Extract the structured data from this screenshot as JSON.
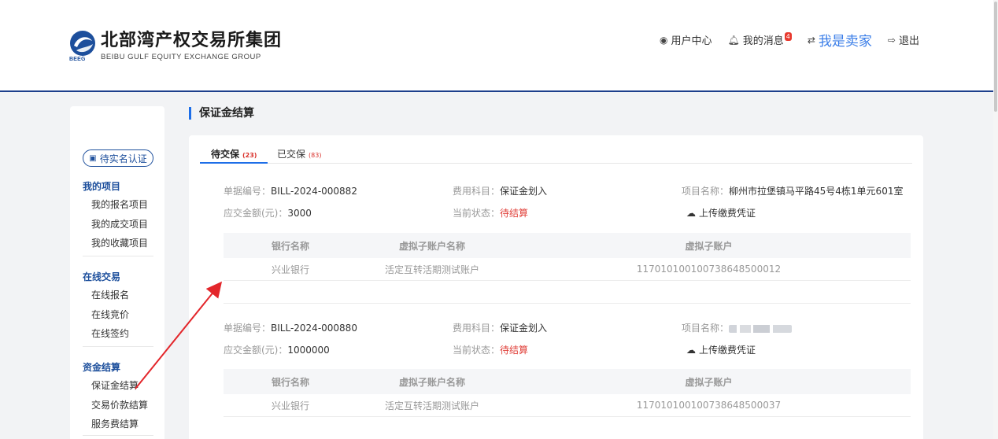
{
  "header": {
    "logo_cn": "北部湾产权交易所集团",
    "logo_en": "BEIBU GULF EQUITY EXCHANGE GROUP",
    "logo_abbr": "BEEG",
    "nav": {
      "user_center": "用户中心",
      "messages": "我的消息",
      "messages_badge": "4",
      "seller": "我是卖家",
      "logout": "退出"
    }
  },
  "sidebar": {
    "verify_button": "待实名认证",
    "groups": [
      {
        "title": "我的项目",
        "items": [
          "我的报名项目",
          "我的成交项目",
          "我的收藏项目"
        ]
      },
      {
        "title": "在线交易",
        "items": [
          "在线报名",
          "在线竞价",
          "在线签约"
        ]
      },
      {
        "title": "资金结算",
        "items": [
          "保证金结算",
          "交易价款结算",
          "服务费结算"
        ]
      }
    ]
  },
  "page": {
    "title": "保证金结算"
  },
  "tabs": [
    {
      "label": "待交保",
      "count": "(23)"
    },
    {
      "label": "已交保",
      "count": "(83)"
    }
  ],
  "labels": {
    "bill_no": "单据编号：",
    "fee_subject": "费用科目：",
    "project_name": "项目名称：",
    "amount": "应交金额(元)：",
    "status": "当前状态：",
    "upload": "上传缴费凭证",
    "col_bank": "银行名称",
    "col_virtual_name": "虚拟子账户名称",
    "col_virtual_account": "虚拟子账户"
  },
  "records": [
    {
      "bill_no": "BILL-2024-000882",
      "fee_subject": "保证金划入",
      "project_name": "柳州市拉堡镇马平路45号4栋1单元601室",
      "amount": "3000",
      "status": "待结算",
      "account": {
        "bank": "兴业银行",
        "virtual_name": "活定互转活期测试账户",
        "virtual_account": "117010100100738648500012"
      }
    },
    {
      "bill_no": "BILL-2024-000880",
      "fee_subject": "保证金划入",
      "project_name": "",
      "amount": "1000000",
      "status": "待结算",
      "account": {
        "bank": "兴业银行",
        "virtual_name": "活定互转活期测试账户",
        "virtual_account": "117010100100738648500037"
      }
    }
  ],
  "colors": {
    "brand": "#1d4f9c",
    "accent": "#1d6ee8",
    "pending": "#e0403a",
    "annotation": "#e3262b"
  }
}
